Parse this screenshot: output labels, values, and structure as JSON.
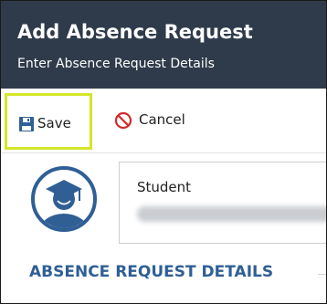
{
  "header": {
    "title": "Add Absence Request",
    "subtitle": "Enter Absence Request Details"
  },
  "toolbar": {
    "save_label": "Save",
    "cancel_label": "Cancel"
  },
  "student": {
    "label": "Student"
  },
  "section": {
    "title": "ABSENCE REQUEST DETAILS"
  },
  "colors": {
    "header_bg": "#2f3b4b",
    "accent_blue": "#2f5f95",
    "highlight": "#d4e62a",
    "cancel_red": "#d22b2b"
  },
  "icons": {
    "save": "save-icon",
    "cancel": "cancel-icon",
    "avatar": "graduate-avatar-icon"
  }
}
